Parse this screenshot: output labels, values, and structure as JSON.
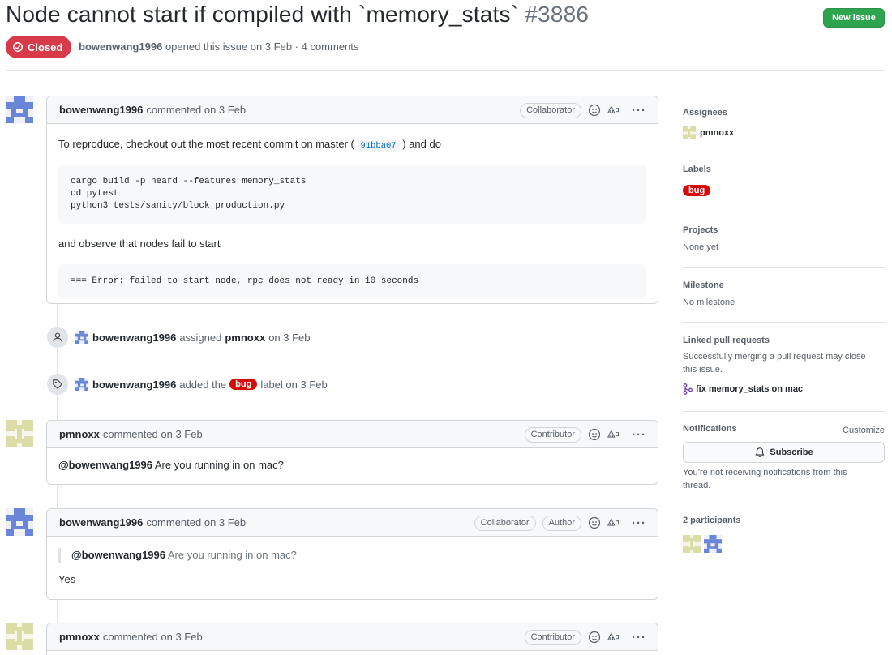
{
  "issue": {
    "title": "Node cannot start if compiled with `memory_stats`",
    "number": "#3886",
    "state": "Closed",
    "author": "bowenwang1996",
    "meta_rest": "opened this issue on 3 Feb · 4 comments",
    "new_issue_label": "New issue"
  },
  "comments": [
    {
      "author": "bowenwang1996",
      "action": "commented on 3 Feb",
      "role": "Collaborator",
      "text1_before": "To reproduce, checkout out the most recent commit on master (",
      "commit": "91bba07",
      "text1_after": ") and do",
      "code1": "cargo build -p neard --features memory_stats\ncd pytest\npython3 tests/sanity/block_production.py",
      "text2": "and observe that nodes fail to start",
      "code2": "=== Error: failed to start node, rpc does not ready in 10 seconds"
    },
    {
      "author": "pmnoxx",
      "action": "commented on 3 Feb",
      "role": "Contributor",
      "mention": "@bowenwang1996",
      "text": "Are you running in on mac?"
    },
    {
      "author": "bowenwang1996",
      "action": "commented on 3 Feb",
      "role": "Collaborator",
      "role2": "Author",
      "quote_mention": "@bowenwang1996",
      "quote_text": "Are you running in on mac?",
      "text": "Yes"
    },
    {
      "author": "pmnoxx",
      "action": "commented on 3 Feb",
      "role": "Contributor"
    }
  ],
  "events": [
    {
      "actor": "bowenwang1996",
      "verb": "assigned",
      "target": "pmnoxx",
      "when": "on 3 Feb"
    },
    {
      "actor": "bowenwang1996",
      "verb": "added the",
      "label": "bug",
      "when": "label on 3 Feb"
    }
  ],
  "sidebar": {
    "assignees_title": "Assignees",
    "assignee": "pmnoxx",
    "labels_title": "Labels",
    "label": "bug",
    "projects_title": "Projects",
    "projects_value": "None yet",
    "milestone_title": "Milestone",
    "milestone_value": "No milestone",
    "linked_title": "Linked pull requests",
    "linked_desc": "Successfully merging a pull request may close this issue.",
    "linked_pr": "fix memory_stats on mac",
    "notif_title": "Notifications",
    "customize": "Customize",
    "subscribe": "Subscribe",
    "notif_desc": "You’re not receiving notifications from this thread.",
    "participants": "2 participants"
  },
  "colors": {
    "closed": "#d73a49",
    "new_issue": "#2ea44f",
    "bug_label": "#d70a0a"
  }
}
